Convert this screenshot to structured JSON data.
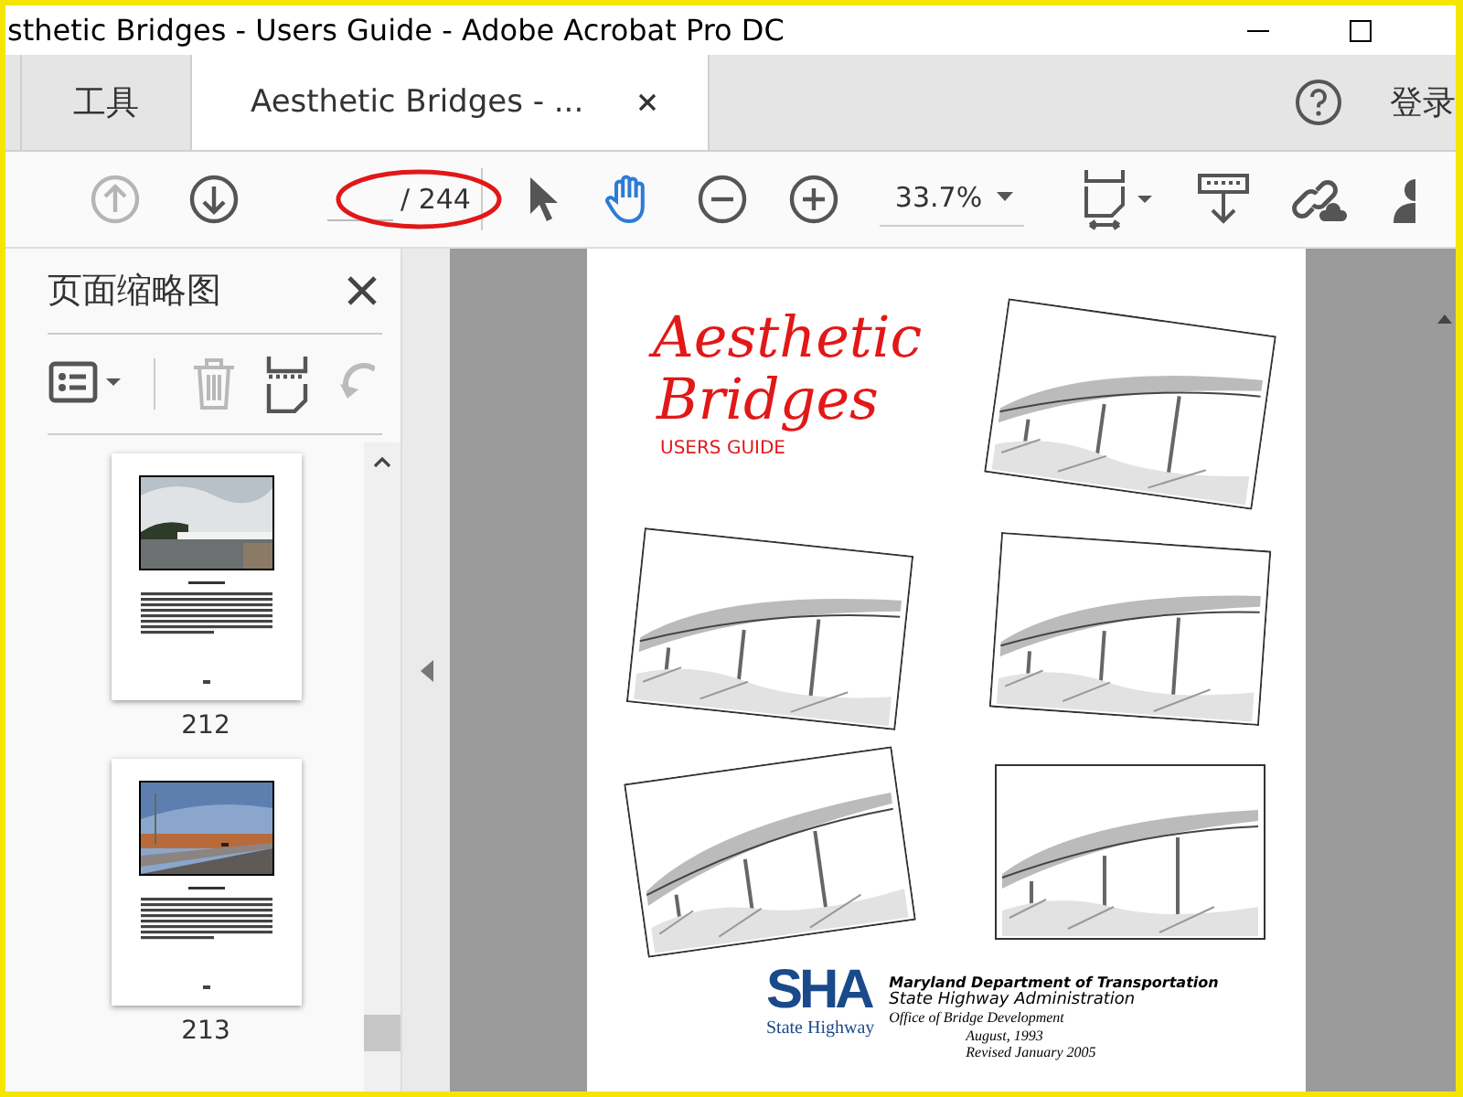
{
  "window": {
    "title": "sthetic Bridges - Users Guide - Adobe Acrobat Pro DC"
  },
  "tabs": [
    {
      "label": "工具",
      "selected": false
    },
    {
      "label": "Aesthetic Bridges - ...",
      "selected": true
    }
  ],
  "account": {
    "label": "登录"
  },
  "toolbar": {
    "nav": [
      {
        "kind": "up",
        "disabled": true
      },
      {
        "kind": "down",
        "disabled": false
      }
    ],
    "page_total": "/ 244",
    "tools": [
      {
        "kind": "pointer",
        "selected": false
      },
      {
        "kind": "hand",
        "selected": true
      }
    ],
    "zoom": "33.7%"
  },
  "sidebar": {
    "title": "页面缩略图",
    "thumbnails": [
      {
        "label": "212",
        "kind": "lake"
      },
      {
        "label": "213",
        "kind": "road"
      }
    ]
  },
  "document": {
    "title_lines": [
      "Aesthetic",
      "Bridges"
    ],
    "subtitle": "USERS GUIDE",
    "logo_text": "SHA",
    "logo_subtext": "State Highway",
    "footer_lines": [
      "Maryland Department of Transportation",
      "State Highway Administration",
      "Office of Bridge Development",
      "August, 1993",
      "Revised January 2005"
    ]
  }
}
